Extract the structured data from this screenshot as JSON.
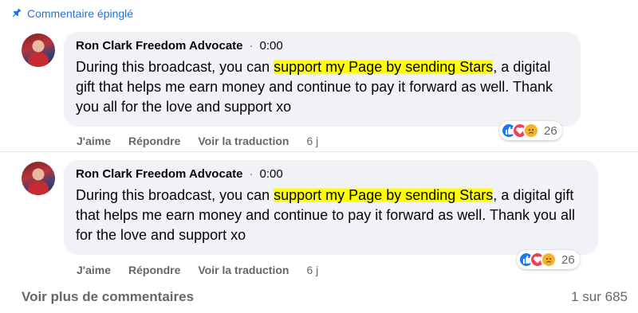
{
  "pinned_label": "Commentaire épinglé",
  "comments": [
    {
      "author": "Ron Clark Freedom Advocate",
      "time": "0:00",
      "text_before": "During this broadcast, you can ",
      "text_highlight": "support my Page by sending Stars",
      "text_after": ", a digital gift that helps me earn money and continue to pay it forward as well. Thank you all for the love and support xo",
      "actions": {
        "like": "J'aime",
        "reply": "Répondre",
        "translate": "Voir la traduction",
        "age": "6 j"
      },
      "reaction_count": "26"
    },
    {
      "author": "Ron Clark Freedom Advocate",
      "time": "0:00",
      "text_before": "During this broadcast, you can ",
      "text_highlight": "support my Page by sending Stars",
      "text_after": ", a digital gift that helps me earn money and continue to pay it forward as well. Thank you all for the love and support xo",
      "actions": {
        "like": "J'aime",
        "reply": "Répondre",
        "translate": "Voir la traduction",
        "age": "6 j"
      },
      "reaction_count": "26"
    }
  ],
  "footer": {
    "more_comments": "Voir plus de commentaires",
    "pagination": "1 sur 685"
  },
  "icons": {
    "pin": "pin-icon",
    "reactions": [
      "like-icon",
      "love-icon",
      "sad-icon"
    ]
  },
  "colors": {
    "accent": "#1b74e4",
    "highlight": "#ffff00",
    "bubble": "#f0f2f5"
  }
}
